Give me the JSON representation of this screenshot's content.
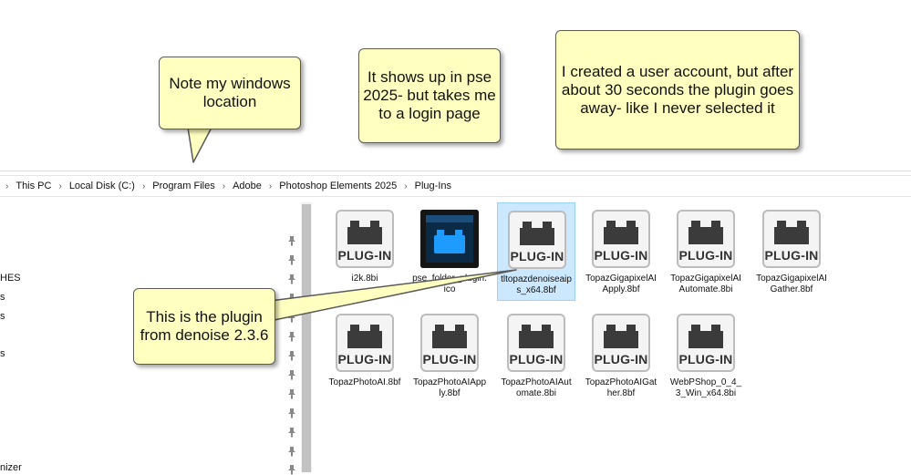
{
  "breadcrumb": [
    "This PC",
    "Local Disk (C:)",
    "Program Files",
    "Adobe",
    "Photoshop Elements 2025",
    "Plug-Ins"
  ],
  "nav_items": [
    "HES",
    "s",
    "s",
    "s",
    "nizer"
  ],
  "plugin_label": "PLUG-IN",
  "files": [
    {
      "name": "i2k.8bi",
      "kind": "plugin"
    },
    {
      "name": "pse_folder_plugin.ico",
      "kind": "folder-icon"
    },
    {
      "name": "tltopazdenoiseaips_x64.8bf",
      "kind": "plugin",
      "selected": true
    },
    {
      "name": "TopazGigapixelAIApply.8bf",
      "kind": "plugin"
    },
    {
      "name": "TopazGigapixelAIAutomate.8bi",
      "kind": "plugin"
    },
    {
      "name": "TopazGigapixelAIGather.8bf",
      "kind": "plugin"
    },
    {
      "name": "TopazPhotoAI.8bf",
      "kind": "plugin"
    },
    {
      "name": "TopazPhotoAIApply.8bf",
      "kind": "plugin"
    },
    {
      "name": "TopazPhotoAIAutomate.8bi",
      "kind": "plugin"
    },
    {
      "name": "TopazPhotoAIGather.8bf",
      "kind": "plugin"
    },
    {
      "name": "WebPShop_0_4_3_Win_x64.8bi",
      "kind": "plugin"
    }
  ],
  "callouts": {
    "location": "Note my windows location",
    "shows_up": "It shows up in pse 2025- but takes me to a login page",
    "account": "I created a user account, but after about 30 seconds the plugin goes away- like I never selected it",
    "denoise": "This is the plugin from denoise 2.3.6"
  },
  "colors": {
    "callout_fill": "#ffffc0",
    "selection": "#cce8ff",
    "folder_icon_blue": "#1e9bff"
  }
}
